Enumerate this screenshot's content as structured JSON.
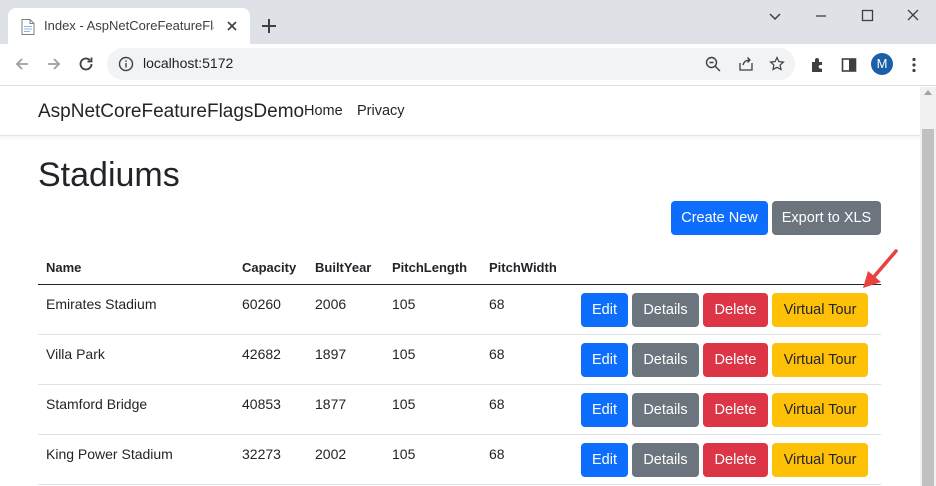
{
  "browser": {
    "tab_title": "Index - AspNetCoreFeatureFlagsD",
    "url": "localhost:5172",
    "avatar_initial": "M"
  },
  "app": {
    "brand": "AspNetCoreFeatureFlagsDemo",
    "nav_home": "Home",
    "nav_privacy": "Privacy"
  },
  "page": {
    "title": "Stadiums",
    "create_label": "Create New",
    "export_label": "Export to XLS"
  },
  "table": {
    "headers": [
      "Name",
      "Capacity",
      "BuiltYear",
      "PitchLength",
      "PitchWidth"
    ],
    "rows": [
      {
        "name": "Emirates Stadium",
        "capacity": "60260",
        "built_year": "2006",
        "pitch_length": "105",
        "pitch_width": "68"
      },
      {
        "name": "Villa Park",
        "capacity": "42682",
        "built_year": "1897",
        "pitch_length": "105",
        "pitch_width": "68"
      },
      {
        "name": "Stamford Bridge",
        "capacity": "40853",
        "built_year": "1877",
        "pitch_length": "105",
        "pitch_width": "68"
      },
      {
        "name": "King Power Stadium",
        "capacity": "32273",
        "built_year": "2002",
        "pitch_length": "105",
        "pitch_width": "68"
      }
    ],
    "actions": {
      "edit": "Edit",
      "details": "Details",
      "delete": "Delete",
      "virtual_tour": "Virtual Tour"
    }
  },
  "colors": {
    "primary": "#0d6efd",
    "secondary": "#6c757d",
    "danger": "#dc3545",
    "warning": "#ffc107",
    "annotation_arrow": "#e8413e"
  }
}
